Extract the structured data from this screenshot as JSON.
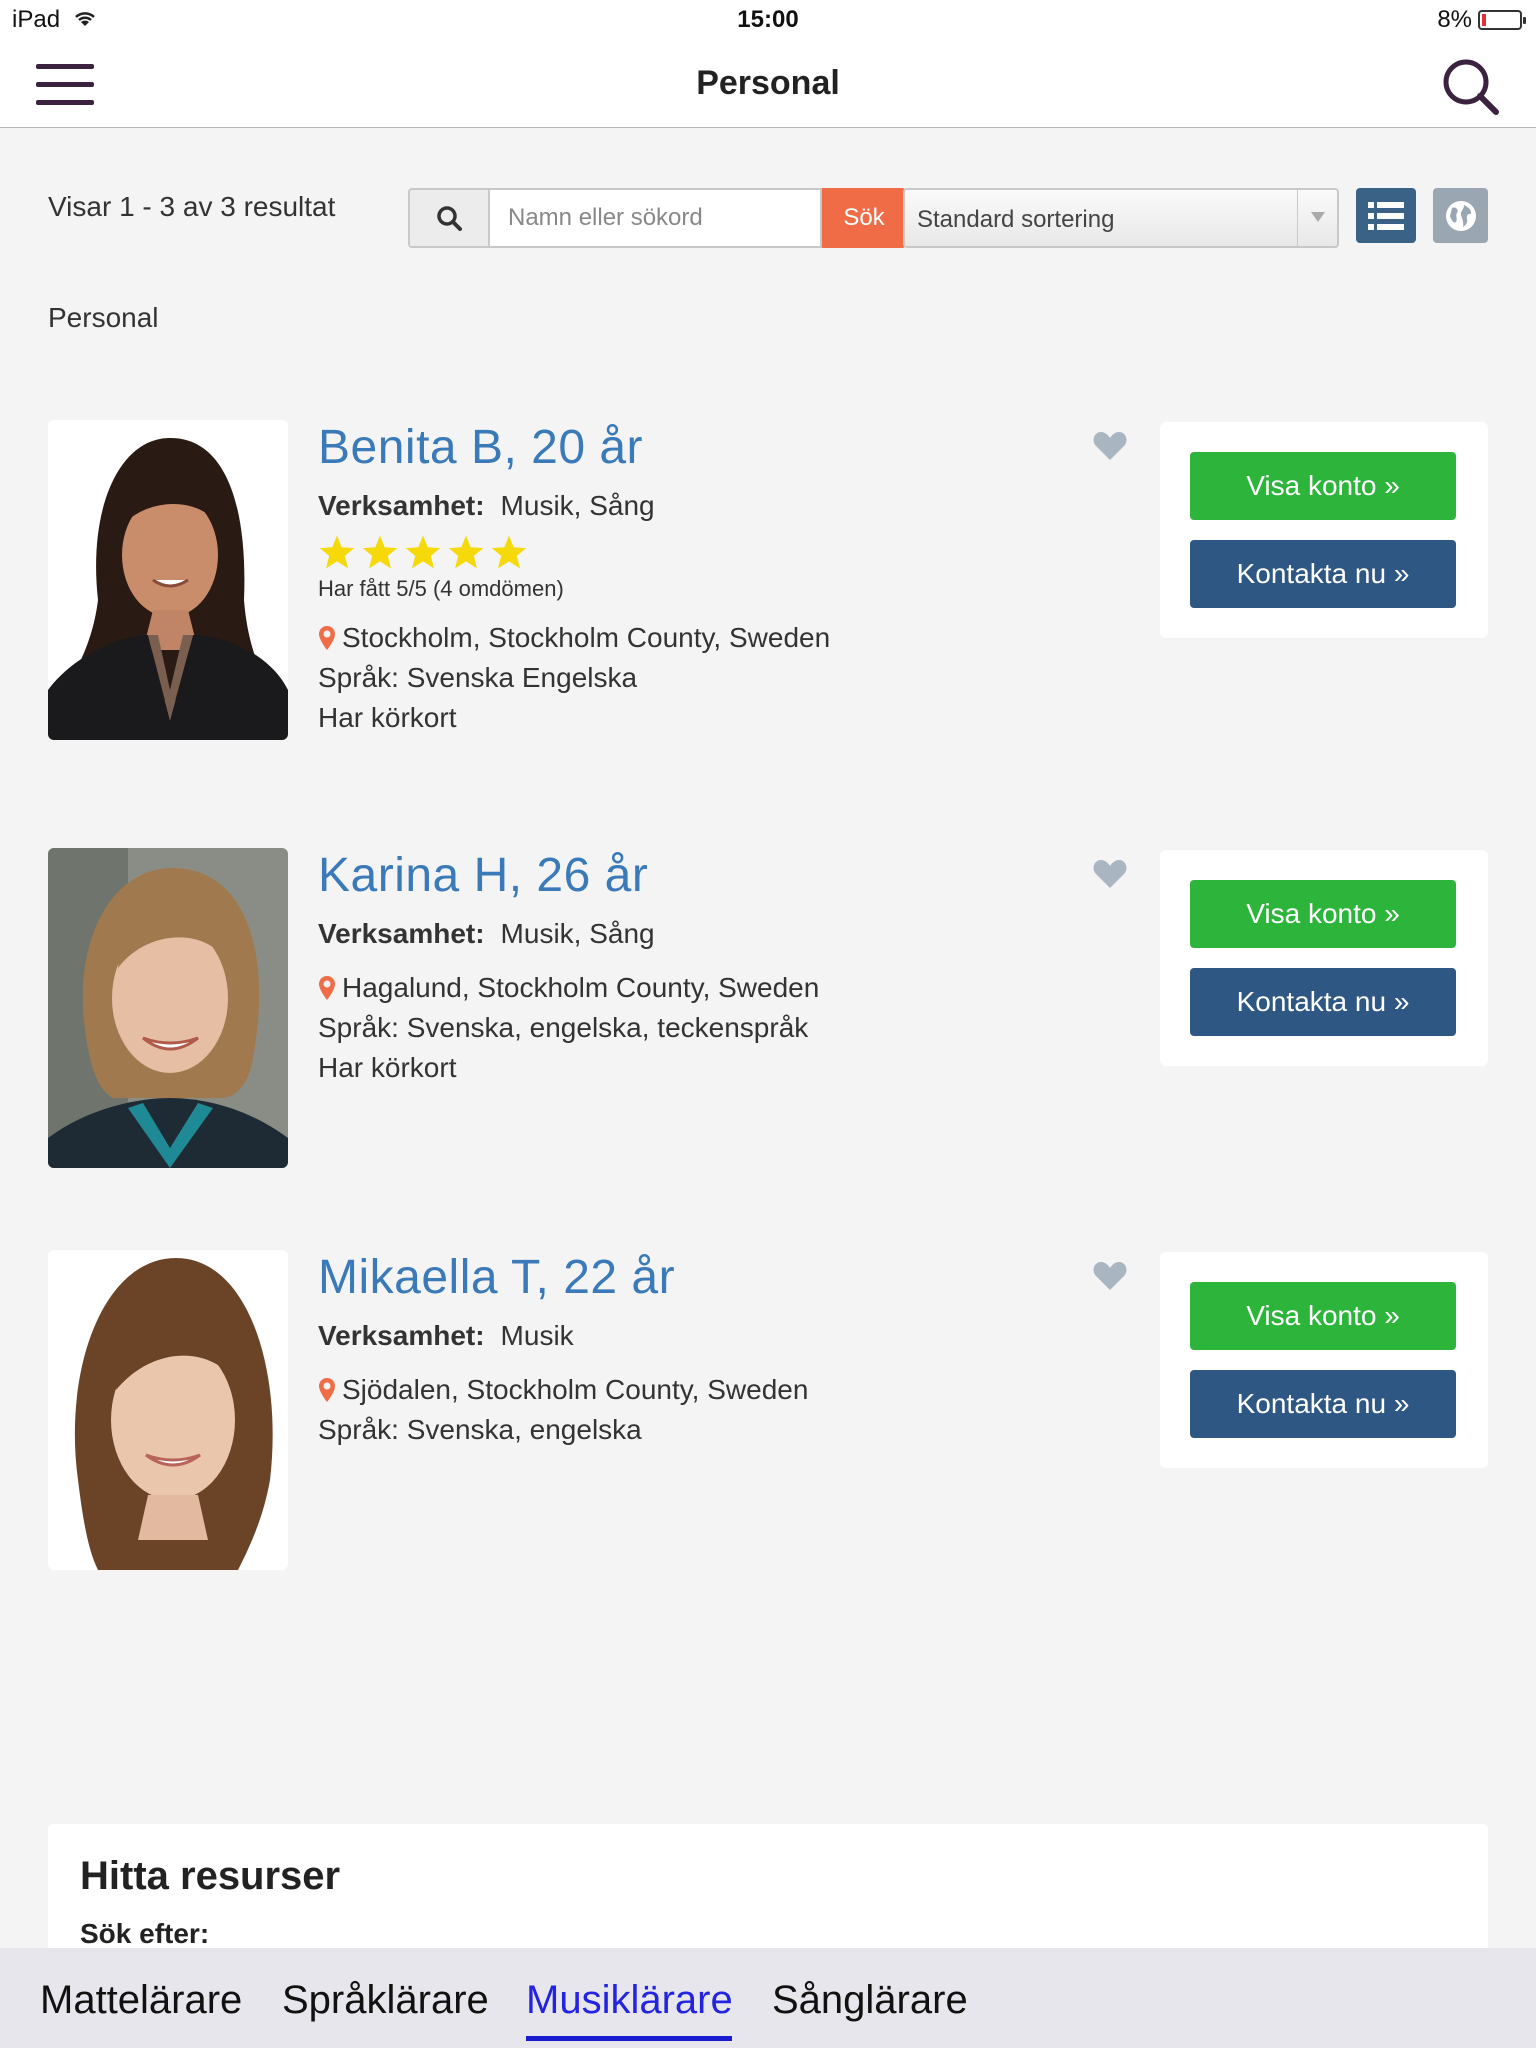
{
  "status_bar": {
    "device": "iPad",
    "time": "15:00",
    "battery": "8%"
  },
  "nav": {
    "title": "Personal"
  },
  "toolbar": {
    "results": "Visar 1 - 3 av 3 resultat",
    "search_placeholder": "Namn eller sökord",
    "search_button": "Sök",
    "sort_selected": "Standard sortering"
  },
  "section_label": "Personal",
  "profiles": [
    {
      "name": "Benita B, 20 år",
      "verksamhet_label": "Verksamhet:",
      "verksamhet": "Musik, Sång",
      "rating": 5,
      "rating_text": "Har fått 5/5 (4 omdömen)",
      "location": "Stockholm, Stockholm County, Sweden",
      "language": "Språk: Svenska Engelska",
      "license": "Har körkort",
      "visa_button": "Visa konto »",
      "kontakt_button": "Kontakta nu »"
    },
    {
      "name": "Karina H, 26 år",
      "verksamhet_label": "Verksamhet:",
      "verksamhet": "Musik, Sång",
      "location": "Hagalund, Stockholm County, Sweden",
      "language": "Språk: Svenska, engelska, teckenspråk",
      "license": "Har körkort",
      "visa_button": "Visa konto »",
      "kontakt_button": "Kontakta nu »"
    },
    {
      "name": "Mikaella T, 22 år",
      "verksamhet_label": "Verksamhet:",
      "verksamhet": "Musik",
      "location": "Sjödalen, Stockholm County, Sweden",
      "language": "Språk: Svenska, engelska",
      "visa_button": "Visa konto »",
      "kontakt_button": "Kontakta nu »"
    }
  ],
  "find_resources": {
    "title": "Hitta resurser",
    "search_for": "Sök efter:"
  },
  "tabs": [
    {
      "label": "Mattelärare",
      "active": false
    },
    {
      "label": "Språklärare",
      "active": false
    },
    {
      "label": "Musiklärare",
      "active": true
    },
    {
      "label": "Sånglärare",
      "active": false
    }
  ],
  "colors": {
    "accent_orange": "#ef6c47",
    "link_blue": "#3a7ab8",
    "button_green": "#2db53b",
    "button_navy": "#2f5784",
    "star_yellow": "#f5d90a",
    "active_tab": "#2424e0"
  },
  "icons": {
    "nav_menu": "hamburger-icon",
    "nav_search": "search-icon",
    "view_list": "list-view-icon",
    "view_map": "globe-icon",
    "favorite": "heart-icon",
    "location": "map-pin-icon",
    "rating": "star-icon"
  }
}
